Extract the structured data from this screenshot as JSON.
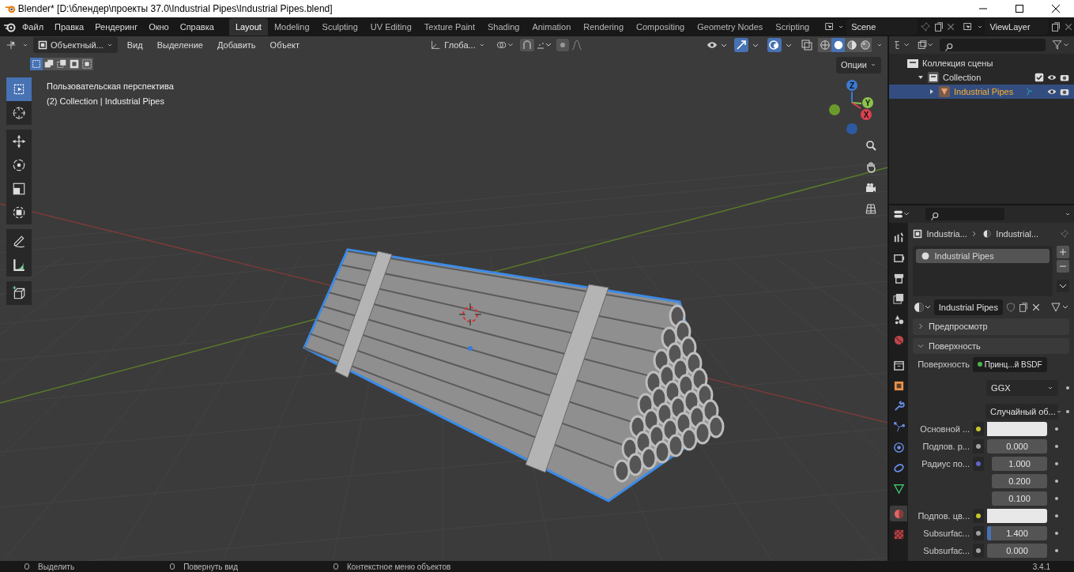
{
  "window": {
    "title": "Blender* [D:\\блендер\\проекты 37.0\\Industrial Pipes\\Industrial Pipes.blend]"
  },
  "menu": [
    "Файл",
    "Правка",
    "Рендеринг",
    "Окно",
    "Справка"
  ],
  "workspaces": [
    {
      "label": "Layout",
      "selected": true
    },
    {
      "label": "Modeling",
      "selected": false
    },
    {
      "label": "Sculpting",
      "selected": false
    },
    {
      "label": "UV Editing",
      "selected": false
    },
    {
      "label": "Texture Paint",
      "selected": false
    },
    {
      "label": "Shading",
      "selected": false
    },
    {
      "label": "Animation",
      "selected": false
    },
    {
      "label": "Rendering",
      "selected": false
    },
    {
      "label": "Compositing",
      "selected": false
    },
    {
      "label": "Geometry Nodes",
      "selected": false
    },
    {
      "label": "Scripting",
      "selected": false
    }
  ],
  "scene": "Scene",
  "view_layer": "ViewLayer",
  "viewport": {
    "mode": "Объектный...",
    "menu": [
      "Вид",
      "Выделение",
      "Добавить",
      "Объект"
    ],
    "orientation": "Глоба...",
    "options": "Опции",
    "select_modes": [
      {
        "kind": "set",
        "selected": true
      },
      {
        "kind": "extend",
        "selected": false
      },
      {
        "kind": "subtract",
        "selected": false
      },
      {
        "kind": "invert",
        "selected": false
      },
      {
        "kind": "intersect",
        "selected": false
      }
    ],
    "shading": [
      {
        "kind": "wireframe",
        "selected": false
      },
      {
        "kind": "solid",
        "selected": true
      },
      {
        "kind": "material",
        "selected": false
      },
      {
        "kind": "rendered",
        "selected": false
      }
    ],
    "info": [
      "Пользовательская перспектива",
      "(2) Collection | Industrial Pipes"
    ],
    "tools": [
      {
        "kind": "select",
        "selected": true
      },
      {
        "kind": "cursor",
        "selected": false
      },
      {
        "kind": "move",
        "selected": false
      },
      {
        "kind": "rotate",
        "selected": false
      },
      {
        "kind": "scale",
        "selected": false
      },
      {
        "kind": "transform",
        "selected": false
      },
      {
        "kind": "annotate",
        "selected": false
      },
      {
        "kind": "measure",
        "selected": false
      },
      {
        "kind": "add-cube",
        "selected": false
      }
    ],
    "gizmo": {
      "x": "X",
      "y": "Y",
      "z": "Z"
    }
  },
  "outliner": {
    "items": [
      {
        "label": "Коллекция сцены",
        "kind": "scene-collection",
        "children": [
          {
            "label": "Collection",
            "kind": "collection",
            "expanded": true,
            "checked": true,
            "children": [
              {
                "label": "Industrial Pipes",
                "kind": "object",
                "expanded": false,
                "selected": true
              }
            ]
          }
        ]
      }
    ]
  },
  "properties": {
    "tabs": [
      {
        "kind": "tool",
        "selected": false
      },
      {
        "kind": "render",
        "selected": false
      },
      {
        "kind": "output",
        "selected": false
      },
      {
        "kind": "view-layer",
        "selected": false
      },
      {
        "kind": "scene",
        "selected": false
      },
      {
        "kind": "world",
        "selected": false
      },
      {
        "kind": "collection",
        "selected": false
      },
      {
        "kind": "object",
        "selected": false
      },
      {
        "kind": "modifier",
        "selected": false
      },
      {
        "kind": "particles",
        "selected": false
      },
      {
        "kind": "physics",
        "selected": false
      },
      {
        "kind": "constraints",
        "selected": false
      },
      {
        "kind": "data",
        "selected": false
      },
      {
        "kind": "material",
        "selected": true
      },
      {
        "kind": "texture",
        "selected": false
      }
    ],
    "breadcrumb": [
      "Industria...",
      "Industrial..."
    ],
    "slots": [
      {
        "label": "Industrial Pipes",
        "selected": true
      }
    ],
    "material": "Industrial Pipes",
    "panels": [
      {
        "label": "Предпросмотр",
        "expanded": false
      },
      {
        "label": "Поверхность",
        "expanded": true
      }
    ],
    "fields": [
      {
        "kind": "link",
        "label": "Поверхность",
        "value": "Принц...й BSDF",
        "color": "#4fb34f"
      },
      {
        "kind": "dropdown",
        "value": "GGX"
      },
      {
        "kind": "dropdown",
        "value": "Случайный об..."
      },
      {
        "kind": "color",
        "label": "Основной ...",
        "color": "#c7c729"
      },
      {
        "kind": "number",
        "label": "Подпов. р...",
        "value": "0.000",
        "color": "#a1a1a1"
      },
      {
        "kind": "vector",
        "label": "Радиус по...",
        "values": [
          "1.000",
          "0.200",
          "0.100"
        ],
        "color": "#6363c7"
      },
      {
        "kind": "color",
        "label": "Подпов. цв...",
        "color": "#c7c729"
      },
      {
        "kind": "slider",
        "label": "Subsurfac...",
        "value": "1.400",
        "level": 0.07,
        "color": "#a1a1a1"
      },
      {
        "kind": "number",
        "label": "Subsurfac...",
        "value": "0.000",
        "color": "#a1a1a1"
      }
    ]
  },
  "status_bar": {
    "hints": [
      "Выделить",
      "Повернуть вид",
      "Контекстное меню объектов"
    ],
    "version": "3.4.1"
  }
}
